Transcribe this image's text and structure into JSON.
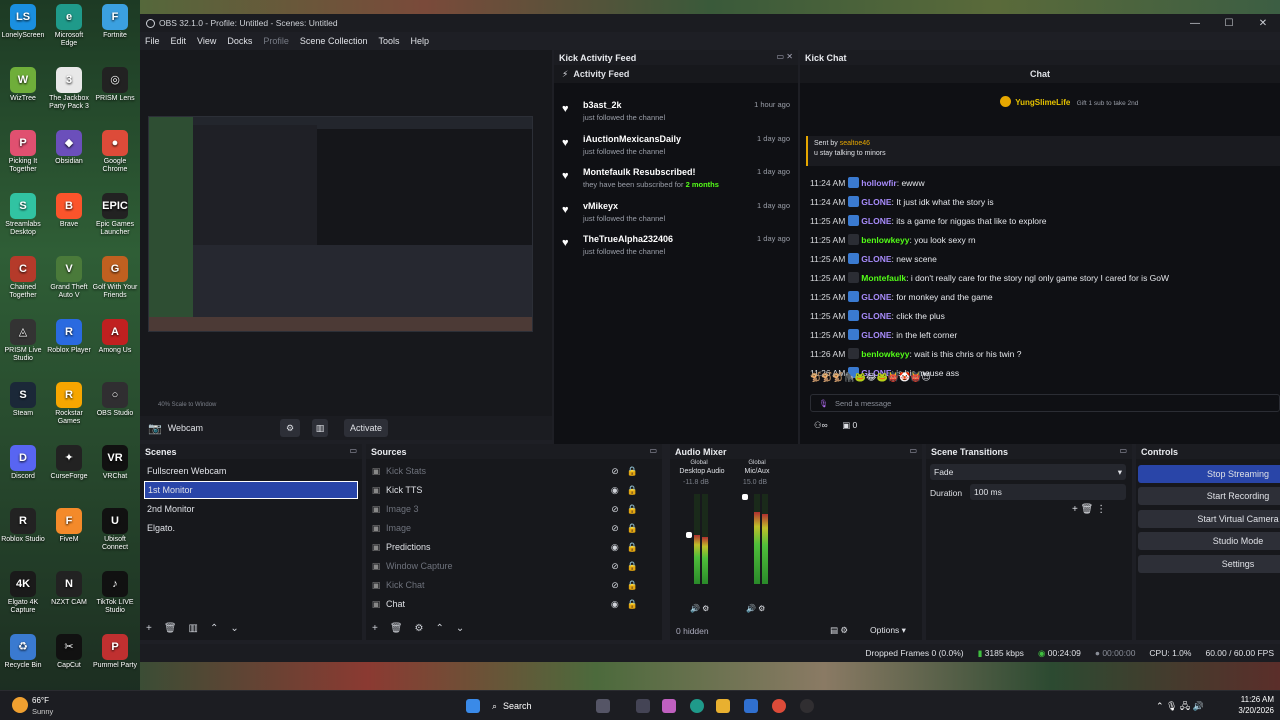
{
  "desktop": {
    "icons": [
      {
        "label": "LonelyScreen",
        "glyph": "LS",
        "color": "#1a8fe0"
      },
      {
        "label": "Microsoft Edge",
        "glyph": "e",
        "color": "#1f9a8a"
      },
      {
        "label": "Fortnite",
        "glyph": "F",
        "color": "#3ba0e0"
      },
      {
        "label": "WizTree",
        "glyph": "W",
        "color": "#6fae3a"
      },
      {
        "label": "The Jackbox Party Pack 3",
        "glyph": "3",
        "color": "#e8e8e8"
      },
      {
        "label": "PRISM Lens",
        "glyph": "◎",
        "color": "#222"
      },
      {
        "label": "Picking It Together",
        "glyph": "P",
        "color": "#e05070"
      },
      {
        "label": "Obsidian",
        "glyph": "◆",
        "color": "#6b4fbb"
      },
      {
        "label": "Google Chrome",
        "glyph": "●",
        "color": "#dd4b39"
      },
      {
        "label": "Streamlabs Desktop",
        "glyph": "S",
        "color": "#31c3a2"
      },
      {
        "label": "Brave",
        "glyph": "B",
        "color": "#fb542b"
      },
      {
        "label": "Epic Games Launcher",
        "glyph": "EPIC",
        "color": "#222"
      },
      {
        "label": "Chained Together",
        "glyph": "C",
        "color": "#b53a2a"
      },
      {
        "label": "Grand Theft Auto V",
        "glyph": "V",
        "color": "#4a7a3a"
      },
      {
        "label": "Golf With Your Friends",
        "glyph": "G",
        "color": "#c06020"
      },
      {
        "label": "PRISM Live Studio",
        "glyph": "◬",
        "color": "#333"
      },
      {
        "label": "Roblox Player",
        "glyph": "R",
        "color": "#2a6ae0"
      },
      {
        "label": "Among Us",
        "glyph": "A",
        "color": "#c02020"
      },
      {
        "label": "Steam",
        "glyph": "S",
        "color": "#1b2838"
      },
      {
        "label": "Rockstar Games",
        "glyph": "R",
        "color": "#f7a600"
      },
      {
        "label": "OBS Studio",
        "glyph": "○",
        "color": "#302e31"
      },
      {
        "label": "Discord",
        "glyph": "D",
        "color": "#5865f2"
      },
      {
        "label": "CurseForge",
        "glyph": "✦",
        "color": "#222"
      },
      {
        "label": "VRChat",
        "glyph": "VR",
        "color": "#111"
      },
      {
        "label": "Roblox Studio",
        "glyph": "R",
        "color": "#222"
      },
      {
        "label": "FiveM",
        "glyph": "F",
        "color": "#f48a2a"
      },
      {
        "label": "Ubisoft Connect",
        "glyph": "U",
        "color": "#111"
      },
      {
        "label": "Elgato 4K Capture",
        "glyph": "4K",
        "color": "#1a1a1a"
      },
      {
        "label": "NZXT CAM",
        "glyph": "N",
        "color": "#222"
      },
      {
        "label": "TikTok LIVE Studio",
        "glyph": "♪",
        "color": "#111"
      },
      {
        "label": "Recycle Bin",
        "glyph": "♻",
        "color": "#3a7ad0"
      },
      {
        "label": "CapCut",
        "glyph": "✂",
        "color": "#111"
      },
      {
        "label": "Pummel Party",
        "glyph": "P",
        "color": "#c03030"
      }
    ]
  },
  "obs": {
    "title": "OBS 32.1.0 - Profile: Untitled - Scenes: Untitled",
    "menu": [
      "File",
      "Edit",
      "View",
      "Docks",
      "Profile",
      "Scene Collection",
      "Tools",
      "Help"
    ],
    "preview_footer": "40%     Scale to Window",
    "source_bar": {
      "label": "Webcam",
      "activate": "Activate"
    },
    "kick_activity": {
      "dock_title": "Kick Activity Feed",
      "header": "Activity Feed",
      "items": [
        {
          "name": "b3ast_2k",
          "desc": "just followed the channel",
          "time": "1 hour ago"
        },
        {
          "name": "iAuctionMexicansDaily",
          "desc": "just followed the channel",
          "time": "1 day ago"
        },
        {
          "name": "Montefaulk Resubscribed!",
          "desc": "they have been subscribed for",
          "months": "2 months",
          "time": "1 day ago"
        },
        {
          "name": "vMikeyx",
          "desc": "just followed the channel",
          "time": "1 day ago"
        },
        {
          "name": "TheTrueAlpha232406",
          "desc": "just followed the channel",
          "time": "1 day ago"
        }
      ]
    },
    "kick_chat": {
      "dock_title": "Kick Chat",
      "header": "Chat",
      "pinned_user": "YungSlimeLife",
      "pinned_text": "Gift 1 sub to take 2nd",
      "overlay_sender": "Sent by",
      "overlay_user": "sealtoe46",
      "overlay_text": "u stay talking to minors",
      "messages": [
        {
          "time": "11:24 AM",
          "user": "hollowfir",
          "color": "#a78bfa",
          "text": ": ewww"
        },
        {
          "time": "11:24 AM",
          "user": "GLONE",
          "color": "#a78bfa",
          "text": ": It just idk what the story is"
        },
        {
          "time": "11:25 AM",
          "user": "GLONE",
          "color": "#a78bfa",
          "text": ": its a game for niggas that like to explore"
        },
        {
          "time": "11:25 AM",
          "user": "benlowkeyy",
          "color": "#53fc18",
          "text": ": you look sexy rn"
        },
        {
          "time": "11:25 AM",
          "user": "GLONE",
          "color": "#a78bfa",
          "text": ": new scene"
        },
        {
          "time": "11:25 AM",
          "user": "Montefaulk",
          "color": "#53fc18",
          "text": ": i don't really care for the story ngl only game story I cared for is GoW"
        },
        {
          "time": "11:25 AM",
          "user": "GLONE",
          "color": "#a78bfa",
          "text": ": for monkey and the game"
        },
        {
          "time": "11:25 AM",
          "user": "GLONE",
          "color": "#a78bfa",
          "text": ": click the plus"
        },
        {
          "time": "11:25 AM",
          "user": "GLONE",
          "color": "#a78bfa",
          "text": ": in the left corner"
        },
        {
          "time": "11:26 AM",
          "user": "benlowkeyy",
          "color": "#53fc18",
          "text": ": wait is this chris or his twin ?"
        },
        {
          "time": "11:26 AM",
          "user": "GLONE",
          "color": "#a78bfa",
          "text": ": is his mouse ass"
        }
      ],
      "input_placeholder": "Send a message",
      "viewer_count": "0"
    },
    "scenes": {
      "title": "Scenes",
      "items": [
        "Fullscreen Webcam",
        "1st Monitor",
        "2nd Monitor",
        "Elgato."
      ],
      "selected": 1
    },
    "sources": {
      "title": "Sources",
      "items": [
        {
          "name": "Kick Stats",
          "dim": true
        },
        {
          "name": "Kick TTS",
          "dim": false
        },
        {
          "name": "Image 3",
          "dim": true
        },
        {
          "name": "Image",
          "dim": true
        },
        {
          "name": "Predictions",
          "dim": false
        },
        {
          "name": "Window Capture",
          "dim": true
        },
        {
          "name": "Kick Chat",
          "dim": true
        },
        {
          "name": "Chat",
          "dim": false
        }
      ]
    },
    "audio": {
      "title": "Audio Mixer",
      "channels": [
        {
          "scope": "Global",
          "name": "Desktop Audio",
          "db": "-11.8 dB",
          "level": 0.55
        },
        {
          "scope": "Global",
          "name": "Mic/Aux",
          "db": "15.0 dB",
          "level": 0.8
        }
      ],
      "hidden": "0 hidden",
      "options": "Options"
    },
    "transitions": {
      "title": "Scene Transitions",
      "selected": "Fade",
      "duration_label": "Duration",
      "duration_value": "100 ms"
    },
    "controls": {
      "title": "Controls",
      "buttons": [
        "Stop Streaming",
        "Start Recording",
        "Start Virtual Camera",
        "Studio Mode",
        "Settings"
      ]
    },
    "status": {
      "dropped": "Dropped Frames 0 (0.0%)",
      "bitrate": "3185 kbps",
      "stream_time": "00:24:09",
      "rec_time": "00:00:00",
      "cpu": "CPU: 1.0%",
      "fps": "60.00 / 60.00 FPS"
    }
  },
  "taskbar": {
    "weather_temp": "66°F",
    "weather_desc": "Sunny",
    "search": "Search",
    "time": "11:26 AM",
    "date": "3/20/2026"
  }
}
